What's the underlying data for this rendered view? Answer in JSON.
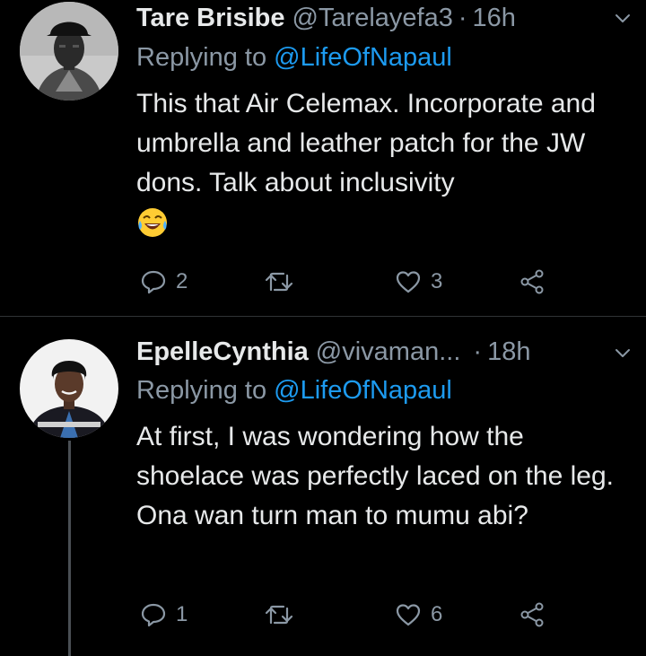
{
  "tweets": [
    {
      "name": "Tare Brisibe",
      "handle": "@Tarelayefa3",
      "dot": "·",
      "time": "16h",
      "replying_prefix": "Replying to",
      "replying_to": "@LifeOfNapaul",
      "text": "This that Air Celemax. Incorporate and umbrella and leather patch for the JW dons. Talk about inclusivity",
      "emoji": "face-with-tears-of-joy",
      "reply_count": "2",
      "retweet_count": "",
      "like_count": "3"
    },
    {
      "name": "EpelleCynthia",
      "handle": "@vivaman...",
      "dot": "·",
      "time": "18h",
      "replying_prefix": "Replying to",
      "replying_to": "@LifeOfNapaul",
      "text": "At first, I was wondering how the shoelace was perfectly laced on the leg. Ona wan turn man to mumu abi?",
      "reply_count": "1",
      "retweet_count": "",
      "like_count": "6"
    }
  ],
  "colors": {
    "background": "#000000",
    "name": "#e7e9ea",
    "muted": "#8b98a5",
    "link": "#1d9bf0",
    "divider": "#2f3336"
  }
}
